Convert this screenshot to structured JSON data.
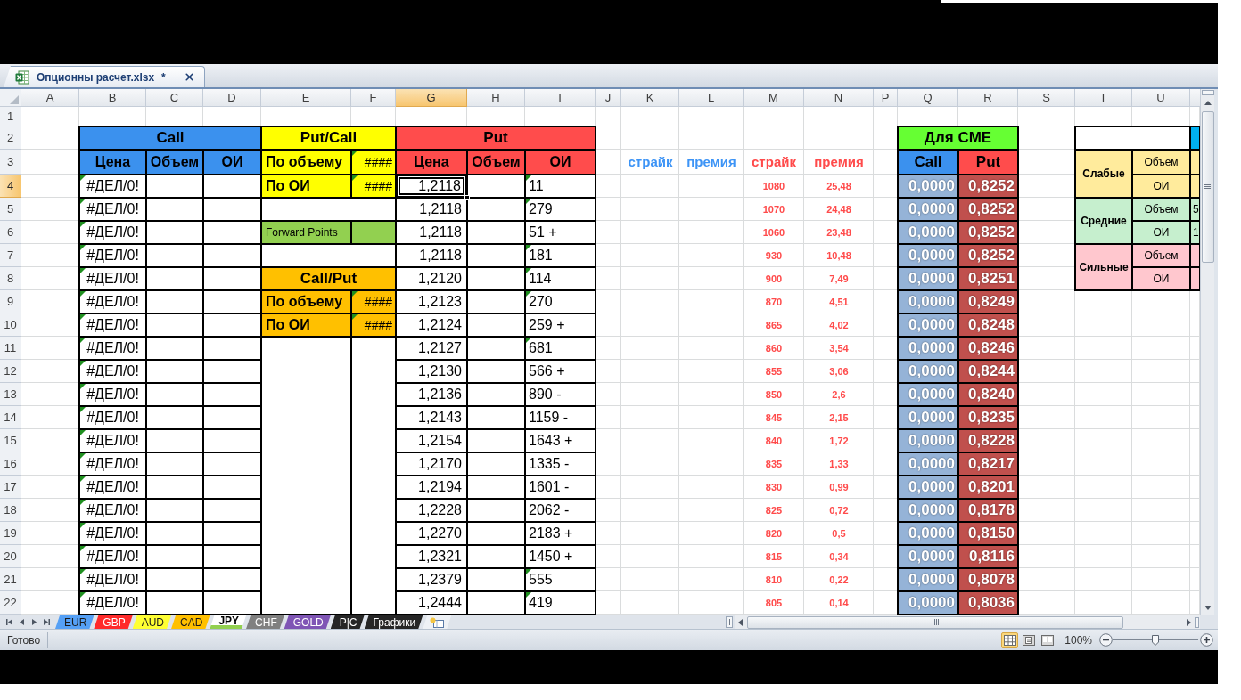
{
  "file_tab": {
    "title": "Опционны расчет.xlsx",
    "modified_mark": "*"
  },
  "column_headers": [
    {
      "label": "A",
      "selected": false
    },
    {
      "label": "B",
      "selected": false
    },
    {
      "label": "C",
      "selected": false
    },
    {
      "label": "D",
      "selected": false
    },
    {
      "label": "E",
      "selected": false
    },
    {
      "label": "F",
      "selected": false
    },
    {
      "label": "G",
      "selected": true
    },
    {
      "label": "H",
      "selected": false
    },
    {
      "label": "I",
      "selected": false
    },
    {
      "label": "J",
      "selected": false
    },
    {
      "label": "K",
      "selected": false
    },
    {
      "label": "L",
      "selected": false
    },
    {
      "label": "M",
      "selected": false
    },
    {
      "label": "N",
      "selected": false
    },
    {
      "label": "P",
      "selected": false
    },
    {
      "label": "Q",
      "selected": false
    },
    {
      "label": "R",
      "selected": false
    },
    {
      "label": "S",
      "selected": false
    },
    {
      "label": "T",
      "selected": false
    },
    {
      "label": "U",
      "selected": false
    }
  ],
  "row_headers": [
    {
      "label": "1",
      "selected": false
    },
    {
      "label": "2",
      "selected": false
    },
    {
      "label": "3",
      "selected": false
    },
    {
      "label": "4",
      "selected": true
    },
    {
      "label": "5",
      "selected": false
    },
    {
      "label": "6",
      "selected": false
    },
    {
      "label": "7",
      "selected": false
    },
    {
      "label": "8",
      "selected": false
    },
    {
      "label": "9",
      "selected": false
    },
    {
      "label": "10",
      "selected": false
    },
    {
      "label": "11",
      "selected": false
    },
    {
      "label": "12",
      "selected": false
    },
    {
      "label": "13",
      "selected": false
    },
    {
      "label": "14",
      "selected": false
    },
    {
      "label": "15",
      "selected": false
    },
    {
      "label": "16",
      "selected": false
    },
    {
      "label": "17",
      "selected": false
    },
    {
      "label": "18",
      "selected": false
    },
    {
      "label": "19",
      "selected": false
    },
    {
      "label": "20",
      "selected": false
    },
    {
      "label": "21",
      "selected": false
    },
    {
      "label": "22",
      "selected": false
    }
  ],
  "call_block": {
    "title": "Call",
    "headers": [
      "Цена",
      "Объем",
      "ОИ"
    ],
    "rows": [
      {
        "price": "#ДЕЛ/0!",
        "error_flag": true
      },
      {
        "price": "#ДЕЛ/0!",
        "error_flag": true
      },
      {
        "price": "#ДЕЛ/0!",
        "error_flag": true
      },
      {
        "price": "#ДЕЛ/0!",
        "error_flag": true
      },
      {
        "price": "#ДЕЛ/0!",
        "error_flag": true
      },
      {
        "price": "#ДЕЛ/0!",
        "error_flag": true
      },
      {
        "price": "#ДЕЛ/0!",
        "error_flag": true
      },
      {
        "price": "#ДЕЛ/0!",
        "error_flag": true
      },
      {
        "price": "#ДЕЛ/0!",
        "error_flag": true
      },
      {
        "price": "#ДЕЛ/0!",
        "error_flag": true
      },
      {
        "price": "#ДЕЛ/0!",
        "error_flag": true
      },
      {
        "price": "#ДЕЛ/0!",
        "error_flag": true
      },
      {
        "price": "#ДЕЛ/0!",
        "error_flag": true
      },
      {
        "price": "#ДЕЛ/0!",
        "error_flag": true
      },
      {
        "price": "#ДЕЛ/0!",
        "error_flag": true
      },
      {
        "price": "#ДЕЛ/0!",
        "error_flag": true
      },
      {
        "price": "#ДЕЛ/0!",
        "error_flag": true
      },
      {
        "price": "#ДЕЛ/0!",
        "error_flag": true
      },
      {
        "price": "#ДЕЛ/0!",
        "error_flag": true
      }
    ]
  },
  "put_call_block": {
    "title": "Put/Call",
    "rows": [
      {
        "label": "По объему",
        "value": "####",
        "error_flag": true
      },
      {
        "label": "По ОИ",
        "value": "####",
        "error_flag": true
      }
    ]
  },
  "forward_points": {
    "label": "Forward Points"
  },
  "call_put_block": {
    "title": "Call/Put",
    "rows": [
      {
        "label": "По объему",
        "value": "####",
        "error_flag": true
      },
      {
        "label": "По ОИ",
        "value": "####",
        "error_flag": true
      }
    ]
  },
  "put_block": {
    "title": "Put",
    "headers": [
      "Цена",
      "Объем",
      "ОИ"
    ],
    "rows": [
      {
        "price": "1,2118",
        "selected": true,
        "oi": "11",
        "error_flag": true
      },
      {
        "price": "1,2118",
        "selected": false,
        "oi": "279",
        "error_flag": true
      },
      {
        "price": "1,2118",
        "selected": false,
        "oi": "51 +",
        "error_flag": false
      },
      {
        "price": "1,2118",
        "selected": false,
        "oi": "181",
        "error_flag": true
      },
      {
        "price": "1,2120",
        "selected": false,
        "oi": "114",
        "error_flag": true
      },
      {
        "price": "1,2123",
        "selected": false,
        "oi": "270",
        "error_flag": true
      },
      {
        "price": "1,2124",
        "selected": false,
        "oi": "259 +",
        "error_flag": false
      },
      {
        "price": "1,2127",
        "selected": false,
        "oi": "681",
        "error_flag": true
      },
      {
        "price": "1,2130",
        "selected": false,
        "oi": "566 +",
        "error_flag": false
      },
      {
        "price": "1,2136",
        "selected": false,
        "oi": "890 -",
        "error_flag": false
      },
      {
        "price": "1,2143",
        "selected": false,
        "oi": "1159 -",
        "error_flag": false
      },
      {
        "price": "1,2154",
        "selected": false,
        "oi": "1643 +",
        "error_flag": false
      },
      {
        "price": "1,2170",
        "selected": false,
        "oi": "1335 -",
        "error_flag": false
      },
      {
        "price": "1,2194",
        "selected": false,
        "oi": "1601 -",
        "error_flag": false
      },
      {
        "price": "1,2228",
        "selected": false,
        "oi": "2062 -",
        "error_flag": false
      },
      {
        "price": "1,2270",
        "selected": false,
        "oi": "2183 +",
        "error_flag": false
      },
      {
        "price": "1,2321",
        "selected": false,
        "oi": "1450 +",
        "error_flag": false
      },
      {
        "price": "1,2379",
        "selected": false,
        "oi": "555",
        "error_flag": true
      },
      {
        "price": "1,2444",
        "selected": false,
        "oi": "419",
        "error_flag": true
      }
    ]
  },
  "strike_headers": [
    {
      "label": "страйк",
      "color": "#3d94f6"
    },
    {
      "label": "премия",
      "color": "#3d94f6"
    },
    {
      "label": "страйк",
      "color": "#ff4b4b"
    },
    {
      "label": "премия",
      "color": "#ff4b4b"
    }
  ],
  "strike_rows": [
    {
      "strike": "1080",
      "premium": "25,48"
    },
    {
      "strike": "1070",
      "premium": "24,48"
    },
    {
      "strike": "1060",
      "premium": "23,48"
    },
    {
      "strike": "930",
      "premium": "10,48"
    },
    {
      "strike": "900",
      "premium": "7,49"
    },
    {
      "strike": "870",
      "premium": "4,51"
    },
    {
      "strike": "865",
      "premium": "4,02"
    },
    {
      "strike": "860",
      "premium": "3,54"
    },
    {
      "strike": "855",
      "premium": "3,06"
    },
    {
      "strike": "850",
      "premium": "2,6"
    },
    {
      "strike": "845",
      "premium": "2,15"
    },
    {
      "strike": "840",
      "premium": "1,72"
    },
    {
      "strike": "835",
      "premium": "1,33"
    },
    {
      "strike": "830",
      "premium": "0,99"
    },
    {
      "strike": "825",
      "premium": "0,72"
    },
    {
      "strike": "820",
      "premium": "0,5"
    },
    {
      "strike": "815",
      "premium": "0,34"
    },
    {
      "strike": "810",
      "premium": "0,22"
    },
    {
      "strike": "805",
      "premium": "0,14"
    }
  ],
  "cme_block": {
    "title": "Для CME",
    "headers": [
      "Call",
      "Put"
    ],
    "rows": [
      {
        "call": "0,0000",
        "put": "0,8252"
      },
      {
        "call": "0,0000",
        "put": "0,8252"
      },
      {
        "call": "0,0000",
        "put": "0,8252"
      },
      {
        "call": "0,0000",
        "put": "0,8252"
      },
      {
        "call": "0,0000",
        "put": "0,8251"
      },
      {
        "call": "0,0000",
        "put": "0,8249"
      },
      {
        "call": "0,0000",
        "put": "0,8248"
      },
      {
        "call": "0,0000",
        "put": "0,8246"
      },
      {
        "call": "0,0000",
        "put": "0,8244"
      },
      {
        "call": "0,0000",
        "put": "0,8240"
      },
      {
        "call": "0,0000",
        "put": "0,8235"
      },
      {
        "call": "0,0000",
        "put": "0,8228"
      },
      {
        "call": "0,0000",
        "put": "0,8217"
      },
      {
        "call": "0,0000",
        "put": "0,8201"
      },
      {
        "call": "0,0000",
        "put": "0,8178"
      },
      {
        "call": "0,0000",
        "put": "0,8150"
      },
      {
        "call": "0,0000",
        "put": "0,8116"
      },
      {
        "call": "0,0000",
        "put": "0,8078"
      },
      {
        "call": "0,0000",
        "put": "0,8036"
      }
    ]
  },
  "strength_block": {
    "groups": [
      {
        "label": "Слабые",
        "color": "#ffeb9c",
        "rows": [
          {
            "label": "Объем"
          },
          {
            "label": "ОИ"
          }
        ]
      },
      {
        "label": "Средние",
        "color": "#c6efce",
        "rows": [
          {
            "label": "Объем",
            "value": "5"
          },
          {
            "label": "ОИ",
            "value": "1"
          }
        ]
      },
      {
        "label": "Сильные",
        "color": "#ffc7ce",
        "rows": [
          {
            "label": "Объем"
          },
          {
            "label": "ОИ"
          }
        ]
      }
    ]
  },
  "sheet_tabs": [
    {
      "label": "EUR",
      "selected": false,
      "color": "#55a0f5"
    },
    {
      "label": "GBP",
      "selected": false,
      "color": "#ff2a2a"
    },
    {
      "label": "AUD",
      "selected": false,
      "color": "#ffff33"
    },
    {
      "label": "CAD",
      "selected": false,
      "color": "#ffc000"
    },
    {
      "label": "JPY",
      "selected": true,
      "color": "#92d050"
    },
    {
      "label": "CHF",
      "selected": false,
      "color": "#808080"
    },
    {
      "label": "GOLD",
      "selected": false,
      "color": "#7f55b5"
    },
    {
      "label": "P|C",
      "selected": false,
      "color": "#262626"
    },
    {
      "label": "Графики",
      "selected": false,
      "color": "#262626"
    }
  ],
  "status_bar": {
    "status": "Готово",
    "views": [
      {
        "kind": "normal",
        "selected": true
      },
      {
        "kind": "page_layout",
        "selected": false
      },
      {
        "kind": "page_break",
        "selected": false
      }
    ],
    "zoom": "100%",
    "zoom_slider": {
      "level": 0.5
    }
  }
}
